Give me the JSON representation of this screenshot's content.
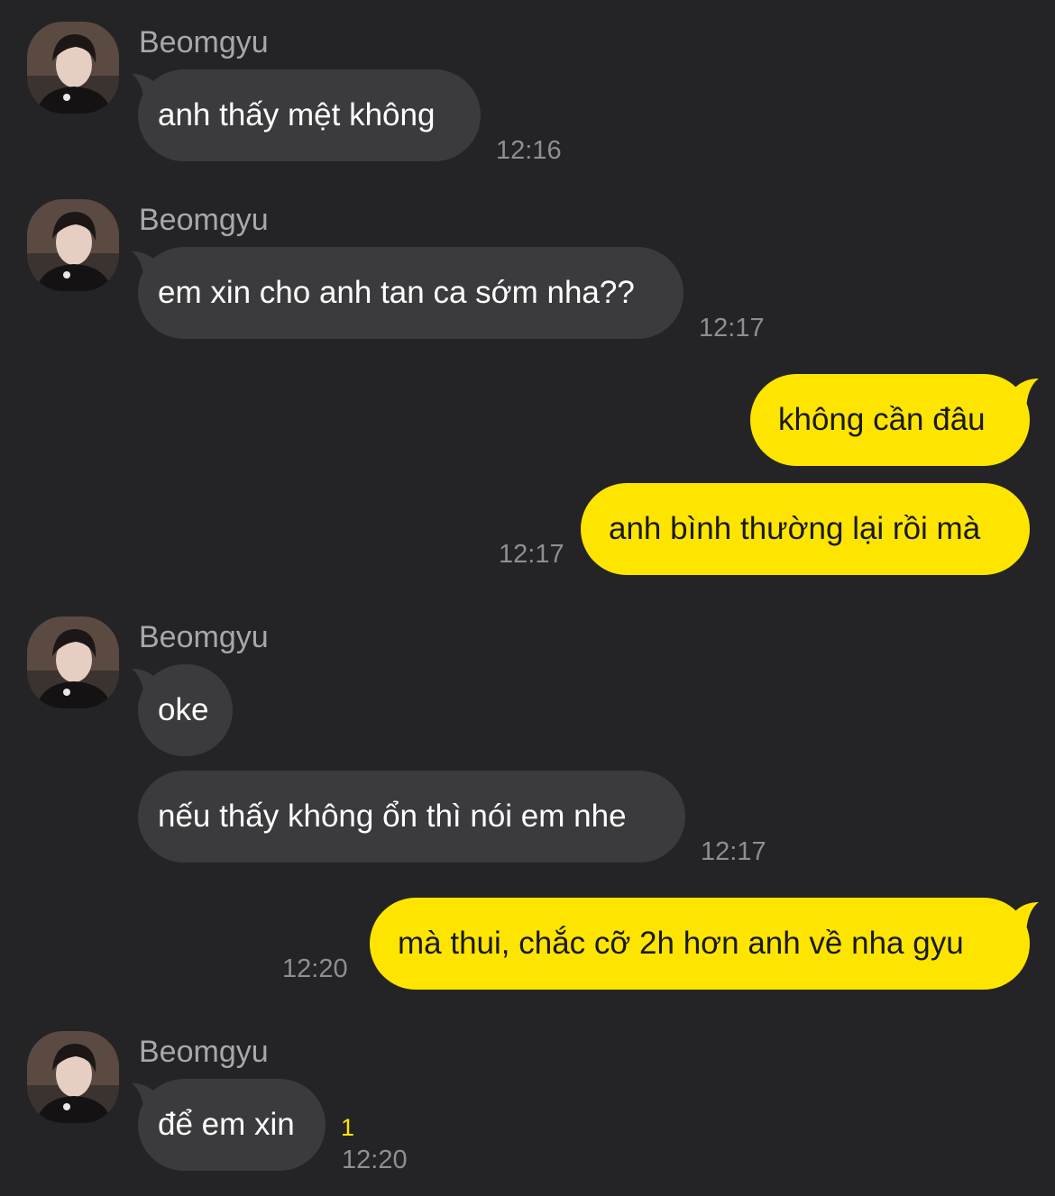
{
  "colors": {
    "background": "#242426",
    "incoming_bubble": "#3b3b3e",
    "outgoing_bubble": "#fee500",
    "timestamp": "#8e8e93",
    "sender_name": "#a8a8ac",
    "unread": "#fee500"
  },
  "contact": {
    "name": "Beomgyu",
    "avatar_icon": "profile-photo"
  },
  "messages": [
    {
      "dir": "in",
      "text": "anh thấy mệt không",
      "time": "12:16"
    },
    {
      "dir": "in",
      "text": "em xin cho anh tan ca sớm nha??",
      "time": "12:17"
    },
    {
      "dir": "out",
      "text": "không cần đâu"
    },
    {
      "dir": "out",
      "text": "anh bình thường lại rồi mà",
      "time": "12:17"
    },
    {
      "dir": "in",
      "text": "oke"
    },
    {
      "dir": "in",
      "text": "nếu thấy không ổn thì nói em nhe",
      "time": "12:17"
    },
    {
      "dir": "out",
      "text": "mà thui, chắc cỡ 2h hơn anh về nha gyu",
      "time": "12:20"
    },
    {
      "dir": "in",
      "text": "để em xin",
      "time": "12:20",
      "unread": "1"
    }
  ]
}
